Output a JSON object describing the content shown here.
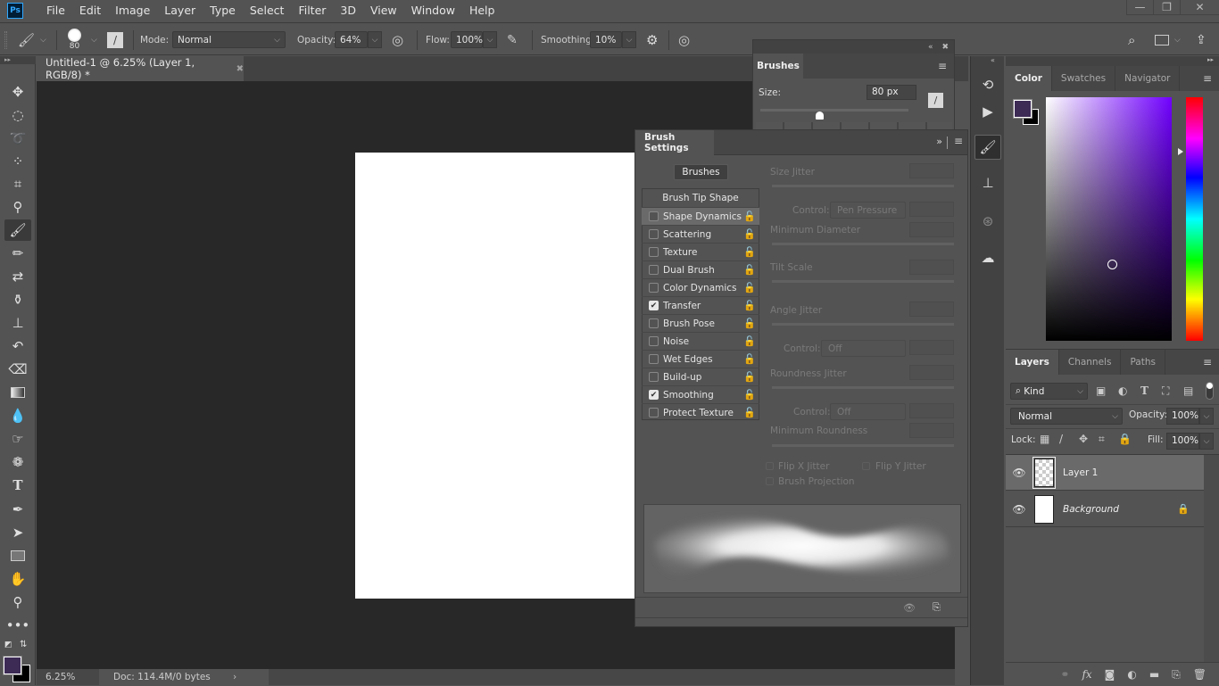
{
  "app": {
    "logo": "Ps"
  },
  "menu": [
    "File",
    "Edit",
    "Image",
    "Layer",
    "Type",
    "Select",
    "Filter",
    "3D",
    "View",
    "Window",
    "Help"
  ],
  "window_controls": {
    "minimize": "—",
    "restore": "❐",
    "close": "✕"
  },
  "options_bar": {
    "brush_size": "80",
    "mode_label": "Mode:",
    "mode_value": "Normal",
    "opacity_label": "Opacity:",
    "opacity_value": "64%",
    "flow_label": "Flow:",
    "flow_value": "100%",
    "smoothing_label": "Smoothing:",
    "smoothing_value": "10%"
  },
  "document": {
    "tab_title": "Untitled-1 @ 6.25% (Layer 1, RGB/8) *",
    "zoom": "6.25%",
    "doc_info": "Doc: 114.4M/0 bytes"
  },
  "brushes_panel": {
    "tab": "Brushes",
    "size_label": "Size:",
    "size_value": "80 px",
    "size_slider_fraction": 0.4
  },
  "brush_settings": {
    "tab": "Brush Settings",
    "brushes_button": "Brushes",
    "tip_shape": "Brush Tip Shape",
    "options": [
      {
        "label": "Shape Dynamics",
        "checked": false,
        "highlighted": true
      },
      {
        "label": "Scattering",
        "checked": false
      },
      {
        "label": "Texture",
        "checked": false
      },
      {
        "label": "Dual Brush",
        "checked": false
      },
      {
        "label": "Color Dynamics",
        "checked": false
      },
      {
        "label": "Transfer",
        "checked": true
      },
      {
        "label": "Brush Pose",
        "checked": false
      },
      {
        "label": "Noise",
        "checked": false
      },
      {
        "label": "Wet Edges",
        "checked": false
      },
      {
        "label": "Build-up",
        "checked": false
      },
      {
        "label": "Smoothing",
        "checked": true
      },
      {
        "label": "Protect Texture",
        "checked": false
      }
    ],
    "size_jitter": "Size Jitter",
    "control_label": "Control:",
    "control1_value": "Pen Pressure",
    "min_diameter": "Minimum Diameter",
    "tilt_scale": "Tilt Scale",
    "angle_jitter": "Angle Jitter",
    "control2_value": "Off",
    "roundness_jitter": "Roundness Jitter",
    "control3_value": "Off",
    "min_roundness": "Minimum Roundness",
    "flip_x": "Flip X Jitter",
    "flip_y": "Flip Y Jitter",
    "brush_projection": "Brush Projection"
  },
  "color_panel": {
    "tabs": [
      "Color",
      "Swatches",
      "Navigator"
    ],
    "foreground": "#3d2a55",
    "background": "#000000",
    "hue_color": "#7000ff"
  },
  "layers_panel": {
    "tabs": [
      "Layers",
      "Channels",
      "Paths"
    ],
    "filter_kind": "Kind",
    "blend_mode": "Normal",
    "opacity_label": "Opacity:",
    "opacity_value": "100%",
    "lock_label": "Lock:",
    "fill_label": "Fill:",
    "fill_value": "100%",
    "layers": [
      {
        "name": "Layer 1",
        "selected": true,
        "transparent": true
      },
      {
        "name": "Background",
        "selected": false,
        "locked": true
      }
    ]
  }
}
